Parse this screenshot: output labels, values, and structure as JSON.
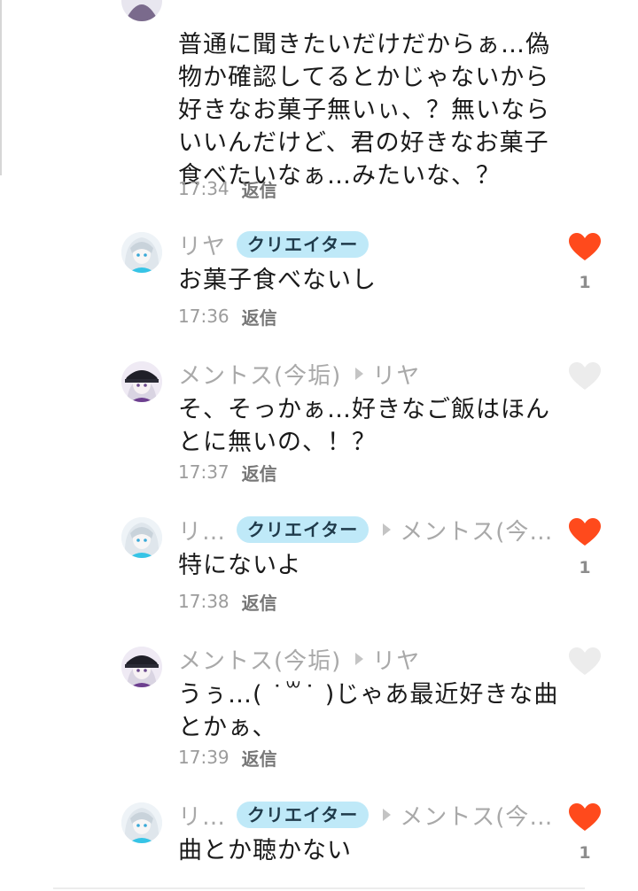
{
  "colors": {
    "liked": "#ff4a1c",
    "unliked": "#ececec",
    "badge_bg": "#bfe9f8"
  },
  "first_comment": {
    "body": "普通に聞きたいだけだからぁ…偽物か確認してるとかじゃないから好きなお菓子無いぃ、？無いならいいんだけど、君の好きなお菓子食べたいなぁ…みたいな、？",
    "time": "17:34",
    "reply_label": "返信"
  },
  "comments": [
    {
      "author": "リヤ",
      "badge": "クリエイター",
      "reply_to": "",
      "body": "お菓子食べないし",
      "time": "17:36",
      "reply_label": "返信",
      "liked": true,
      "likes": "1",
      "avatar": "white-hair-avatar"
    },
    {
      "author": "メントス(今垢)",
      "badge": "",
      "reply_to": "リヤ",
      "body": "そ、そっかぁ…好きなご飯はほんとに無いの、！？",
      "time": "17:37",
      "reply_label": "返信",
      "liked": false,
      "likes": "",
      "avatar": "black-cap-avatar"
    },
    {
      "author": "リ…",
      "badge": "クリエイター",
      "reply_to": "メントス(今…",
      "body": "特にないよ",
      "time": "17:38",
      "reply_label": "返信",
      "liked": true,
      "likes": "1",
      "avatar": "white-hair-avatar"
    },
    {
      "author": "メントス(今垢)",
      "badge": "",
      "reply_to": "リヤ",
      "body": "うぅ…( ˙꒳˙ )じゃあ最近好きな曲とかぁ、",
      "time": "17:39",
      "reply_label": "返信",
      "liked": false,
      "likes": "",
      "avatar": "black-cap-avatar"
    },
    {
      "author": "リ…",
      "badge": "クリエイター",
      "reply_to": "メントス(今…",
      "body": "曲とか聴かない",
      "time": "",
      "reply_label": "",
      "liked": true,
      "likes": "1",
      "avatar": "white-hair-avatar"
    }
  ]
}
